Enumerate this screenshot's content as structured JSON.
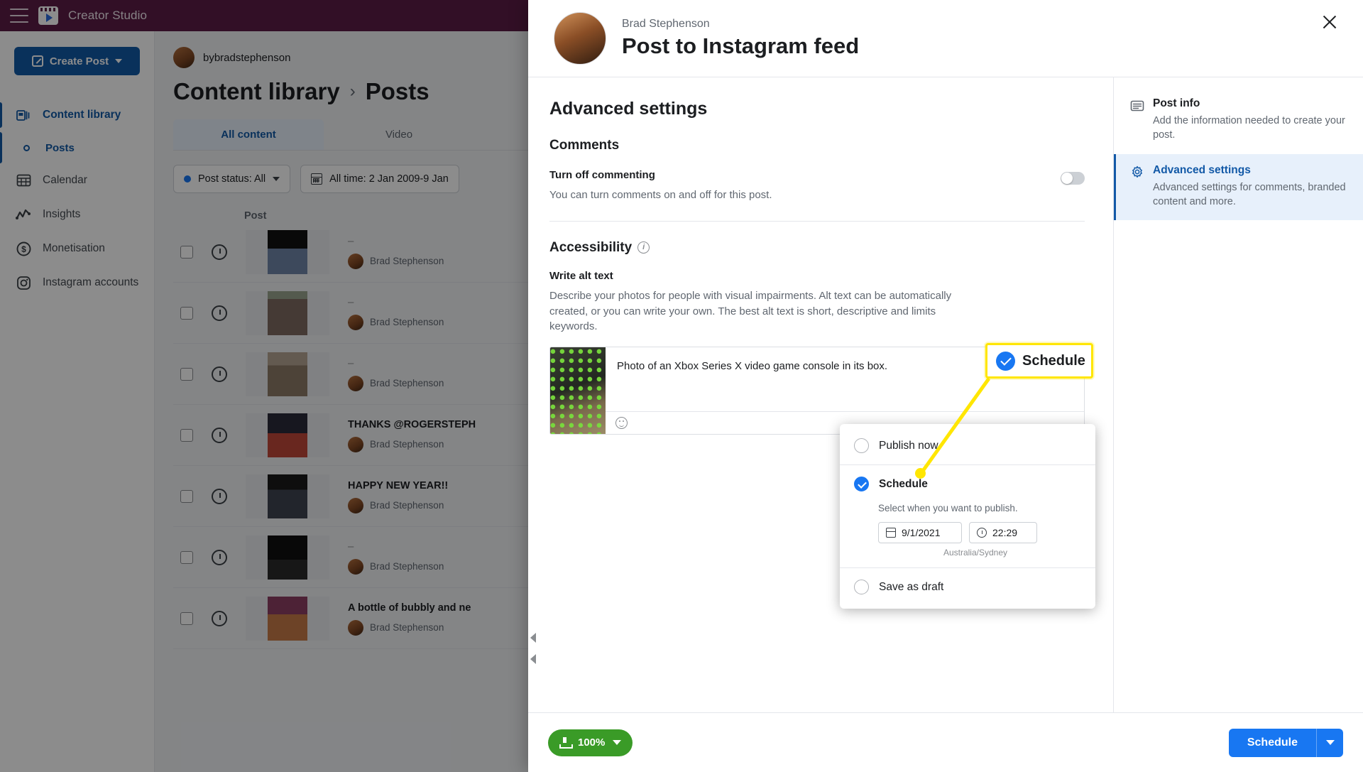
{
  "topbar": {
    "brand": "Creator Studio",
    "menu_icon": "hamburger-icon",
    "logo_icon": "creator-studio-logo"
  },
  "sidebar": {
    "create_post": "Create Post",
    "items": [
      {
        "label": "Content library",
        "icon": "library-icon",
        "active": true
      },
      {
        "label": "Posts",
        "icon": "dot-circle-icon",
        "active": true
      },
      {
        "label": "Calendar",
        "icon": "calendar-icon",
        "active": false
      },
      {
        "label": "Insights",
        "icon": "insights-chart-icon",
        "active": false
      },
      {
        "label": "Monetisation",
        "icon": "dollar-circle-icon",
        "active": false
      },
      {
        "label": "Instagram accounts",
        "icon": "instagram-icon",
        "active": false
      }
    ]
  },
  "main": {
    "account": "bybradstephenson",
    "breadcrumb": {
      "parent": "Content library",
      "separator": "›",
      "current": "Posts"
    },
    "tabs": [
      {
        "label": "All content",
        "active": true
      },
      {
        "label": "Video",
        "active": false
      }
    ],
    "filters": [
      {
        "label": "Post status: All",
        "icon": "status-dot-icon"
      },
      {
        "label": "All time: 2 Jan 2009-9 Jan",
        "icon": "calendar-icon"
      }
    ],
    "table_header": "Post",
    "rows": [
      {
        "title": "–",
        "author": "Brad Stephenson"
      },
      {
        "title": "–",
        "author": "Brad Stephenson"
      },
      {
        "title": "–",
        "author": "Brad Stephenson"
      },
      {
        "title": "THANKS @ROGERSTEPH",
        "author": "Brad Stephenson"
      },
      {
        "title": "HAPPY NEW YEAR!!",
        "author": "Brad Stephenson"
      },
      {
        "title": "–",
        "author": "Brad Stephenson"
      },
      {
        "title": "A bottle of bubbly and ne",
        "author": "Brad Stephenson"
      }
    ]
  },
  "modal": {
    "author": "Brad Stephenson",
    "title": "Post to Instagram feed",
    "close_icon": "close-icon",
    "section_title": "Advanced settings",
    "comments": {
      "heading": "Comments",
      "toggle_label": "Turn off commenting",
      "toggle_desc": "You can turn comments on and off for this post.",
      "toggle_on": false
    },
    "accessibility": {
      "heading": "Accessibility",
      "info_icon": "info-icon",
      "field_label": "Write alt text",
      "field_desc": "Describe your photos for people with visual impairments. Alt text can be automatically created, or you can write your own. The best alt text is short, descriptive and limits keywords.",
      "alt_value": "Photo of an Xbox Series X video game console in its box.",
      "emoji_icon": "emoji-icon",
      "thumb_icon": "xbox-series-x-photo"
    },
    "side_nav": [
      {
        "label": "Post info",
        "desc": "Add the information needed to create your post.",
        "icon": "post-info-icon",
        "active": false
      },
      {
        "label": "Advanced settings",
        "desc": "Advanced settings for comments, branded content and more.",
        "icon": "gear-icon",
        "active": true
      }
    ],
    "footer": {
      "upload_pct": "100%",
      "upload_icon": "upload-icon",
      "pct_caret_icon": "chevron-down-icon",
      "schedule_label": "Schedule",
      "schedule_caret_icon": "chevron-down-icon"
    }
  },
  "schedule_dropdown": {
    "options": [
      {
        "label": "Publish now",
        "selected": false
      },
      {
        "label": "Schedule",
        "selected": true
      },
      {
        "label": "Save as draft",
        "selected": false
      }
    ],
    "hint": "Select when you want to publish.",
    "date_value": "9/1/2021",
    "time_value": "22:29",
    "timezone": "Australia/Sydney",
    "date_icon": "calendar-icon",
    "time_icon": "clock-icon"
  },
  "annotation": {
    "label": "Schedule",
    "check_icon": "check-circle-icon",
    "highlight_color": "#ffe600",
    "line_color": "#ffe600"
  },
  "colors": {
    "brand_purple": "#5b1d45",
    "primary_blue": "#1877f2",
    "nav_blue": "#1259a7",
    "green": "#3a9b27",
    "highlight_yellow": "#ffe600"
  }
}
